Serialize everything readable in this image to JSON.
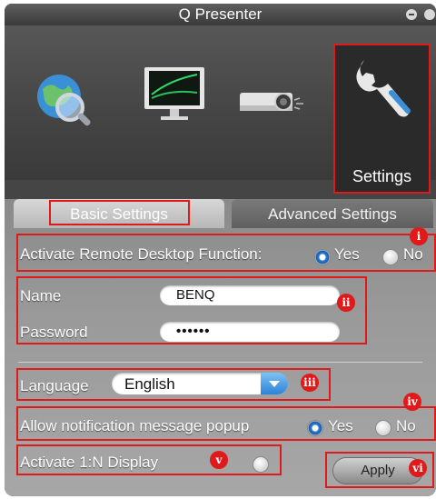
{
  "window": {
    "title": "Q Presenter"
  },
  "toolbar": {
    "items": [
      {
        "name": "internet"
      },
      {
        "name": "display"
      },
      {
        "name": "projector"
      },
      {
        "name": "settings",
        "label": "Settings",
        "selected": true
      }
    ]
  },
  "tabs": [
    {
      "label": "Basic Settings",
      "active": true
    },
    {
      "label": "Advanced Settings",
      "active": false
    }
  ],
  "remote_desktop": {
    "label": "Activate Remote Desktop Function:",
    "yes": "Yes",
    "no": "No",
    "selected": "Yes"
  },
  "credentials": {
    "name_label": "Name",
    "name_value": "BENQ",
    "password_label": "Password",
    "password_mask": "••••••"
  },
  "language": {
    "label": "Language",
    "value": "English"
  },
  "notification": {
    "label": "Allow notification message popup",
    "yes": "Yes",
    "no": "No",
    "selected": "Yes"
  },
  "display_1n": {
    "label": "Activate 1:N Display",
    "enabled": false
  },
  "apply_label": "Apply",
  "callouts": [
    "i",
    "ii",
    "iii",
    "iv",
    "v",
    "vi"
  ],
  "colors": {
    "callout_red": "#e0191b",
    "radio_blue": "#2e7fd3"
  }
}
